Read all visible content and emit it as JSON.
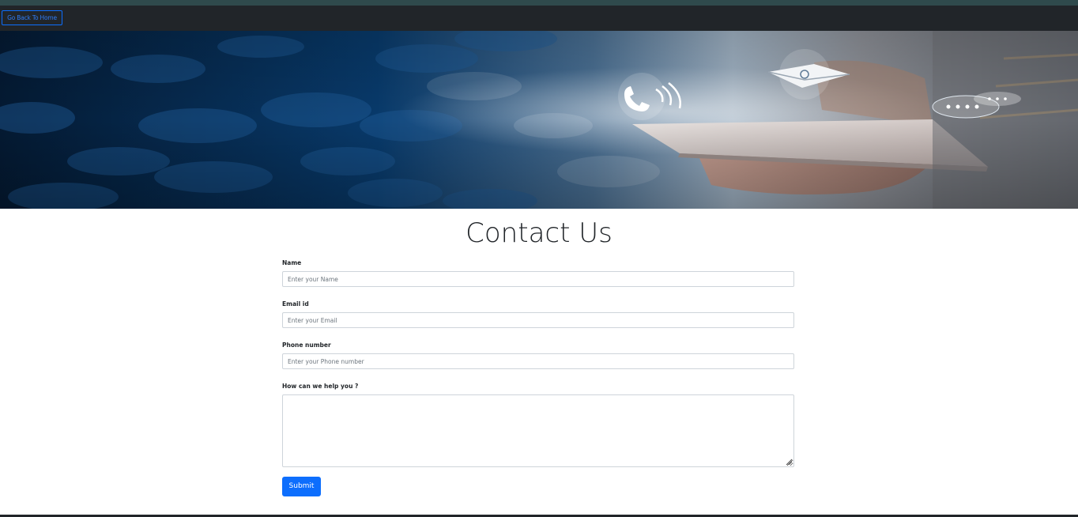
{
  "nav": {
    "home_button_label": "Go Back To Home"
  },
  "hero": {
    "image_alt": "contact-banner"
  },
  "page": {
    "title": "Contact Us"
  },
  "form": {
    "name": {
      "label": "Name",
      "placeholder": "Enter your Name",
      "value": ""
    },
    "email": {
      "label": "Email id",
      "placeholder": "Enter your Email",
      "value": ""
    },
    "phone": {
      "label": "Phone number",
      "placeholder": "Enter your Phone number",
      "value": ""
    },
    "message": {
      "label": "How can we help you ?",
      "value": ""
    },
    "submit_label": "Submit"
  },
  "colors": {
    "navbar": "#212529",
    "accent": "#0d6efd",
    "hero_blue": "#0b3f73"
  }
}
